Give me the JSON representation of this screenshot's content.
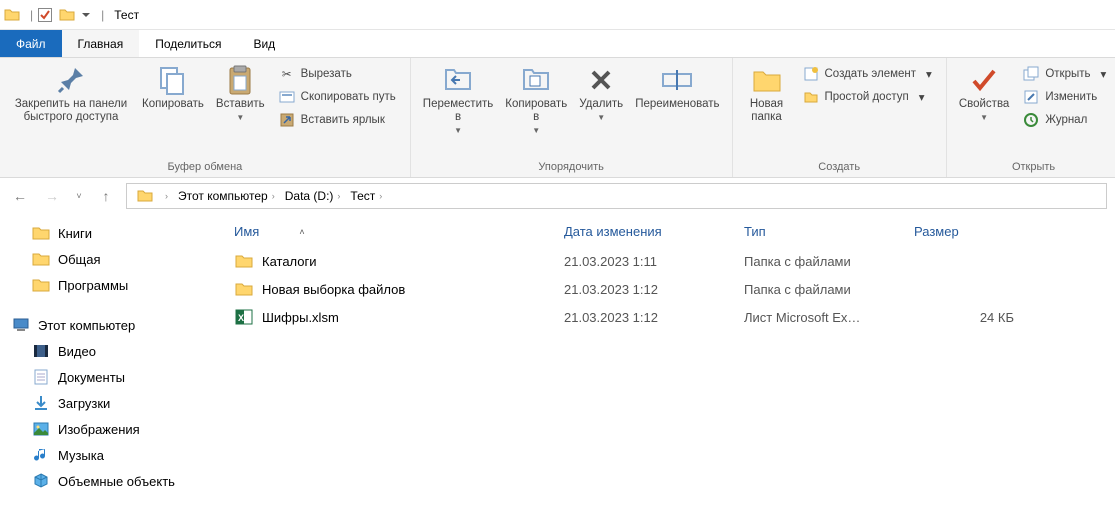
{
  "title": "Тест",
  "tabs": {
    "file": "Файл",
    "home": "Главная",
    "share": "Поделиться",
    "view": "Вид"
  },
  "ribbon": {
    "clipboard": {
      "label": "Буфер обмена",
      "pin": "Закрепить на панели\nбыстрого доступа",
      "copy": "Копировать",
      "paste": "Вставить",
      "cut": "Вырезать",
      "copy_path": "Скопировать путь",
      "paste_shortcut": "Вставить ярлык"
    },
    "organize": {
      "label": "Упорядочить",
      "move_to": "Переместить\nв",
      "copy_to": "Копировать\nв",
      "delete": "Удалить",
      "rename": "Переименовать"
    },
    "new": {
      "label": "Создать",
      "new_folder": "Новая\nпапка",
      "new_item": "Создать элемент",
      "easy_access": "Простой доступ"
    },
    "open": {
      "label": "Открыть",
      "properties": "Свойства",
      "open": "Открыть",
      "edit": "Изменить",
      "history": "Журнал"
    }
  },
  "breadcrumbs": [
    "Этот компьютер",
    "Data (D:)",
    "Тест"
  ],
  "columns": {
    "name": "Имя",
    "date": "Дата изменения",
    "type": "Тип",
    "size": "Размер"
  },
  "files": [
    {
      "icon": "folder",
      "name": "Каталоги",
      "date": "21.03.2023 1:11",
      "type": "Папка с файлами",
      "size": ""
    },
    {
      "icon": "folder",
      "name": "Новая выборка файлов",
      "date": "21.03.2023 1:12",
      "type": "Папка с файлами",
      "size": ""
    },
    {
      "icon": "excel",
      "name": "Шифры.xlsm",
      "date": "21.03.2023 1:12",
      "type": "Лист Microsoft Ex…",
      "size": "24 КБ"
    }
  ],
  "sidebar": [
    {
      "icon": "folder",
      "label": "Книги",
      "level": 1
    },
    {
      "icon": "folder",
      "label": "Общая",
      "level": 1
    },
    {
      "icon": "folder",
      "label": "Программы",
      "level": 1
    },
    {
      "spacer": true
    },
    {
      "icon": "computer",
      "label": "Этот компьютер",
      "level": 0
    },
    {
      "icon": "video",
      "label": "Видео",
      "level": 1
    },
    {
      "icon": "document",
      "label": "Документы",
      "level": 1
    },
    {
      "icon": "download",
      "label": "Загрузки",
      "level": 1
    },
    {
      "icon": "picture",
      "label": "Изображения",
      "level": 1
    },
    {
      "icon": "music",
      "label": "Музыка",
      "level": 1
    },
    {
      "icon": "cube",
      "label": "Объемные объекть",
      "level": 1
    }
  ]
}
